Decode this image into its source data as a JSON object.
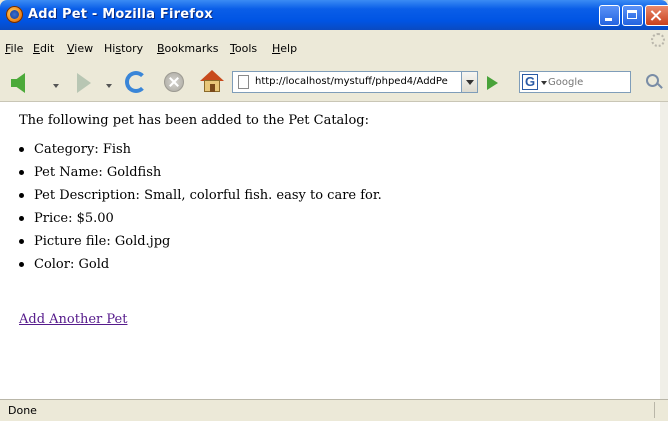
{
  "window": {
    "title": "Add Pet - Mozilla Firefox"
  },
  "menu": {
    "items": [
      {
        "pre": "",
        "acc": "F",
        "post": "ile"
      },
      {
        "pre": "",
        "acc": "E",
        "post": "dit"
      },
      {
        "pre": "",
        "acc": "V",
        "post": "iew"
      },
      {
        "pre": "Hi",
        "acc": "s",
        "post": "tory"
      },
      {
        "pre": "",
        "acc": "B",
        "post": "ookmarks"
      },
      {
        "pre": "",
        "acc": "T",
        "post": "ools"
      },
      {
        "pre": "",
        "acc": "H",
        "post": "elp"
      }
    ]
  },
  "toolbar": {
    "url": "http://localhost/mystuff/phped4/AddPe",
    "search_placeholder": "Google",
    "search_engine_letter": "G"
  },
  "page": {
    "intro": "The following pet has been added to the Pet Catalog:",
    "details": [
      "Category: Fish",
      "Pet Name: Goldfish",
      "Pet Description: Small, colorful fish. easy to care for.",
      "Price: $5.00",
      "Picture file: Gold.jpg",
      "Color: Gold"
    ],
    "link": "Add Another Pet"
  },
  "status": {
    "text": "Done"
  },
  "colors": {
    "title_bar": "#0054e3",
    "link_visited": "#551a8b",
    "chrome": "#ece9d8"
  }
}
